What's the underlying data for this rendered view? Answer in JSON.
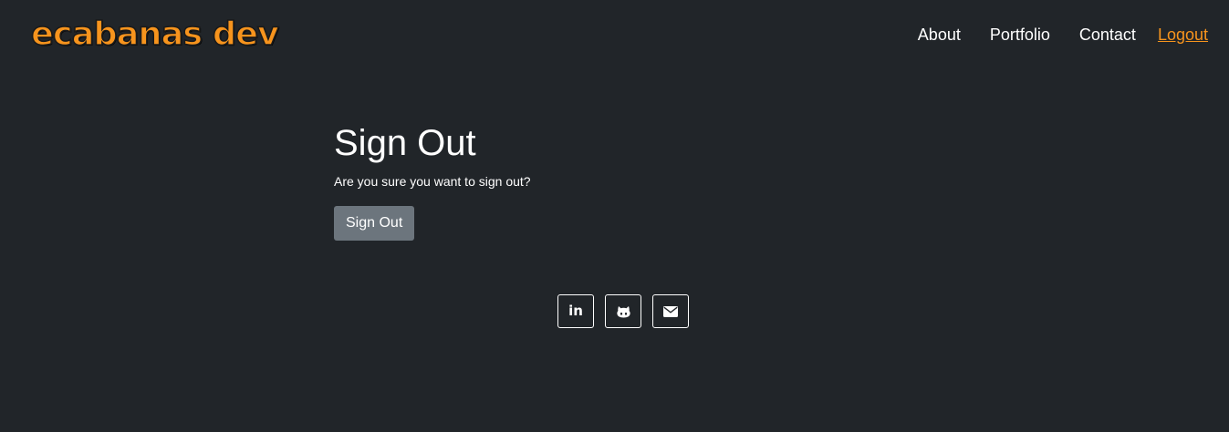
{
  "brand": {
    "text": "ecabanas dev",
    "color": "#f7941d"
  },
  "nav": {
    "items": [
      {
        "label": "About"
      },
      {
        "label": "Portfolio"
      },
      {
        "label": "Contact"
      },
      {
        "label": "Logout",
        "active": true
      }
    ]
  },
  "main": {
    "title": "Sign Out",
    "message": "Are you sure you want to sign out?",
    "button_label": "Sign Out"
  },
  "social": {
    "linkedin": {
      "icon": "linkedin-icon",
      "glyph": "in"
    },
    "github": {
      "icon": "github-icon"
    },
    "email": {
      "icon": "envelope-icon"
    }
  },
  "colors": {
    "background": "#212529",
    "accent": "#f7941d",
    "button": "#6c757d",
    "text": "#ffffff"
  }
}
